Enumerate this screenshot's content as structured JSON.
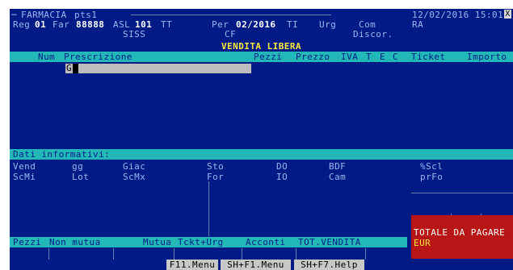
{
  "header": {
    "app": "FARMACIA",
    "tty": "pts1",
    "datetime": "12/02/2016 15:01",
    "close_glyph": "X",
    "reg_label": "Reg",
    "reg_value": "01",
    "far_label": "Far",
    "far_value": "88888",
    "asl_label": "ASL",
    "asl_value": "101",
    "asl_suffix": "TT",
    "per_label": "Per",
    "per_value": "02/2016",
    "per_suffix": "TI",
    "urg_label": "Urg",
    "com_label": "Com",
    "ra_label": "RA",
    "siss_label": "SISS",
    "cf_label": "CF",
    "discor_label": "Discor."
  },
  "vendita": {
    "title": "VENDITA LIBERA",
    "columns": {
      "num": "Num",
      "prescrizione": "Prescrizione",
      "pezzi": "Pezzi",
      "prezzo": "Prezzo",
      "iva": "IVA",
      "t": "T",
      "e": "E",
      "c": "C",
      "ticket": "Ticket",
      "importo": "Importo"
    },
    "input_value": "G"
  },
  "dati": {
    "title": "Dati informativi:",
    "row1": [
      "Vend",
      "gg",
      "Giac",
      "Sto",
      "DO",
      "BDF",
      "%Scl"
    ],
    "row2": [
      "ScMi",
      "Lot",
      "ScMx",
      "For",
      "IO",
      "Cam",
      "prFo"
    ]
  },
  "totals": {
    "pezzi": "Pezzi",
    "non_mutua": "Non mutua",
    "mutua": "Mutua",
    "tckt_urg": "Tckt+Urg",
    "acconti": "Acconti",
    "tot_vendita": "TOT.VENDITA"
  },
  "totale_box": {
    "label": "TOTALE DA PAGARE",
    "currency": "EUR"
  },
  "function_keys": [
    "F11.Menu",
    "SH+F1.Menu",
    "SH+F7.Help"
  ],
  "colors": {
    "screen_bg": "#001a86",
    "bar": "#22b8b8",
    "input_bar": "#bdbdbd",
    "totale_bg": "#b81616",
    "text_dim": "#9fb6f2",
    "text_bright": "#ffffff"
  }
}
